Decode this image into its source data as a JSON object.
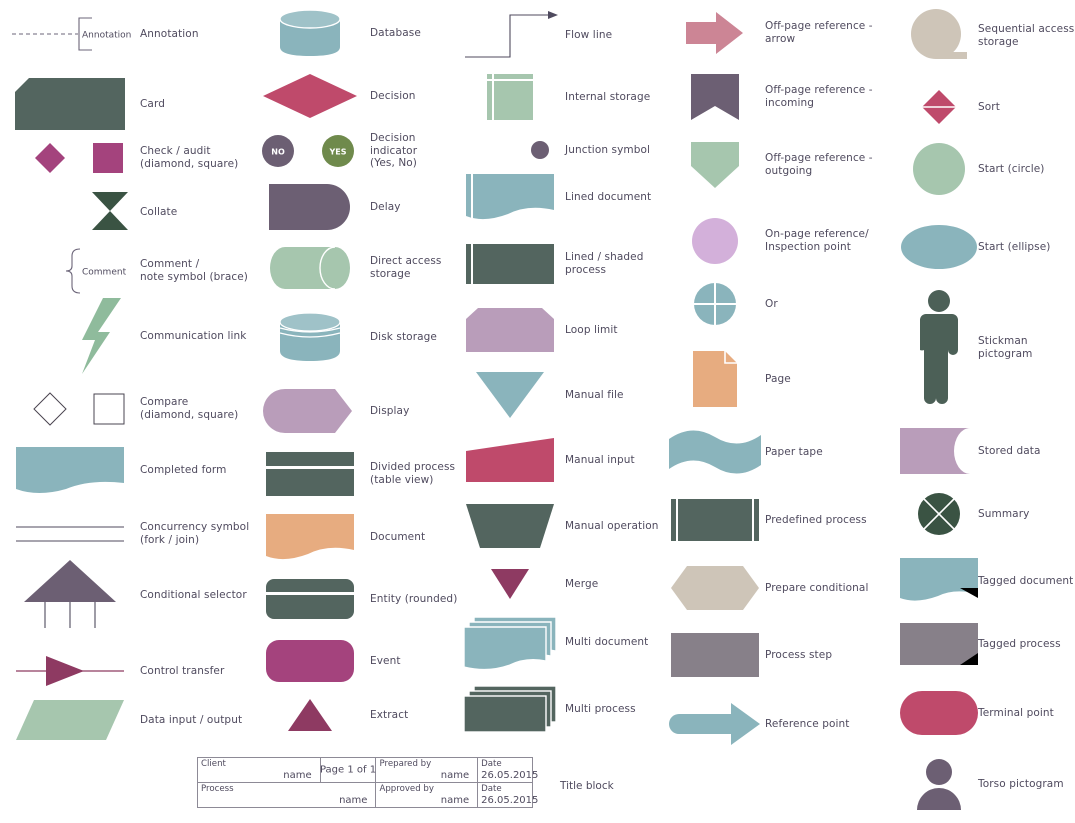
{
  "page": {
    "title": "Flowchart symbols library",
    "background": "#ffffff",
    "label_color": "#4f4a5e"
  },
  "palette": {
    "slate_green": "#53655f",
    "teal": "#8ab4bc",
    "teal_dark": "#7fa9b2",
    "crimson": "#bf4a6b",
    "magenta": "#a4437d",
    "plum": "#8e3a62",
    "purple_gray": "#6c5f73",
    "mauve": "#b99dba",
    "lilac": "#d3b0da",
    "sage": "#a6c6ae",
    "peach": "#e7ac80",
    "rose": "#cc8595",
    "taupe": "#cec5b8",
    "gray": "#878089",
    "dark_green": "#3a5343",
    "outline": "#6b6478",
    "wine": "#a03a5e"
  },
  "columns": [
    {
      "id": "column-1",
      "items": [
        {
          "key": "annotation",
          "label": "Annotation",
          "inner_text": "Annotation"
        },
        {
          "key": "card",
          "label": "Card"
        },
        {
          "key": "check-audit",
          "label": "Check / audit\n(diamond, square)"
        },
        {
          "key": "collate",
          "label": "Collate"
        },
        {
          "key": "comment-note",
          "label": "Comment /\nnote symbol (brace)",
          "inner_text": "Comment"
        },
        {
          "key": "communication-link",
          "label": "Communication link"
        },
        {
          "key": "compare",
          "label": "Compare\n(diamond, square)"
        },
        {
          "key": "completed-form",
          "label": "Completed form"
        },
        {
          "key": "concurrency-symbol",
          "label": "Concurrency symbol\n(fork / join)"
        },
        {
          "key": "conditional-selector",
          "label": "Conditional selector"
        },
        {
          "key": "control-transfer",
          "label": "Control transfer"
        },
        {
          "key": "data-input-output",
          "label": "Data input / output"
        }
      ]
    },
    {
      "id": "column-2",
      "items": [
        {
          "key": "database",
          "label": "Database"
        },
        {
          "key": "decision",
          "label": "Decision"
        },
        {
          "key": "decision-indicator",
          "label": "Decision indicator\n(Yes, No)",
          "no_text": "NO",
          "yes_text": "YES"
        },
        {
          "key": "delay",
          "label": "Delay"
        },
        {
          "key": "direct-access-storage",
          "label": "Direct access storage"
        },
        {
          "key": "disk-storage",
          "label": "Disk storage"
        },
        {
          "key": "display",
          "label": "Display"
        },
        {
          "key": "divided-process",
          "label": "Divided process\n(table view)"
        },
        {
          "key": "document",
          "label": "Document"
        },
        {
          "key": "entity-rounded",
          "label": "Entity (rounded)"
        },
        {
          "key": "event",
          "label": "Event"
        },
        {
          "key": "extract",
          "label": "Extract"
        }
      ]
    },
    {
      "id": "column-3",
      "items": [
        {
          "key": "flow-line",
          "label": "Flow line"
        },
        {
          "key": "internal-storage",
          "label": "Internal storage"
        },
        {
          "key": "junction-symbol",
          "label": "Junction symbol"
        },
        {
          "key": "lined-document",
          "label": "Lined document"
        },
        {
          "key": "lined-shaded-process",
          "label": "Lined / shaded process"
        },
        {
          "key": "loop-limit",
          "label": "Loop limit"
        },
        {
          "key": "manual-file",
          "label": "Manual file"
        },
        {
          "key": "manual-input",
          "label": "Manual input"
        },
        {
          "key": "manual-operation",
          "label": "Manual operation"
        },
        {
          "key": "merge",
          "label": "Merge"
        },
        {
          "key": "multi-document",
          "label": "Multi document"
        },
        {
          "key": "multi-process",
          "label": "Multi process"
        }
      ]
    },
    {
      "id": "column-4",
      "items": [
        {
          "key": "offpage-arrow",
          "label": "Off-page reference -\narrow"
        },
        {
          "key": "offpage-incoming",
          "label": "Off-page reference -\nincoming"
        },
        {
          "key": "offpage-outgoing",
          "label": "Off-page reference -\noutgoing"
        },
        {
          "key": "onpage-reference",
          "label": "On-page reference/\nInspection point"
        },
        {
          "key": "or",
          "label": "Or"
        },
        {
          "key": "page",
          "label": "Page"
        },
        {
          "key": "paper-tape",
          "label": "Paper tape"
        },
        {
          "key": "predefined-process",
          "label": "Predefined process"
        },
        {
          "key": "prepare-conditional",
          "label": "Prepare conditional"
        },
        {
          "key": "process-step",
          "label": "Process step"
        },
        {
          "key": "reference-point",
          "label": "Reference point"
        }
      ]
    },
    {
      "id": "column-5",
      "items": [
        {
          "key": "sequential-access-storage",
          "label": "Sequential access\nstorage"
        },
        {
          "key": "sort",
          "label": "Sort"
        },
        {
          "key": "start-circle",
          "label": "Start (circle)"
        },
        {
          "key": "start-ellipse",
          "label": "Start (ellipse)"
        },
        {
          "key": "stickman-pictogram",
          "label": "Stickman pictogram"
        },
        {
          "key": "stored-data",
          "label": "Stored data"
        },
        {
          "key": "summary",
          "label": "Summary"
        },
        {
          "key": "tagged-document",
          "label": "Tagged document"
        },
        {
          "key": "tagged-process",
          "label": "Tagged process"
        },
        {
          "key": "terminal-point",
          "label": "Terminal point"
        },
        {
          "key": "torso-pictogram",
          "label": "Torso pictogram"
        }
      ]
    }
  ],
  "title_block": {
    "label": "Title block",
    "rows": [
      {
        "cells": [
          {
            "head": "Client",
            "value": "name"
          },
          {
            "page_prefix": "Page",
            "page_number": "1",
            "page_of": "of",
            "page_total": "1"
          },
          {
            "head": "Prepared by",
            "value": "name"
          },
          {
            "head": "Date",
            "value": "26.05.2015"
          }
        ]
      },
      {
        "cells": [
          {
            "head": "Process",
            "value": "name"
          },
          {
            "head": "Approved by",
            "value": "name"
          },
          {
            "head": "Date",
            "value": "26.05.2015"
          }
        ]
      }
    ]
  }
}
